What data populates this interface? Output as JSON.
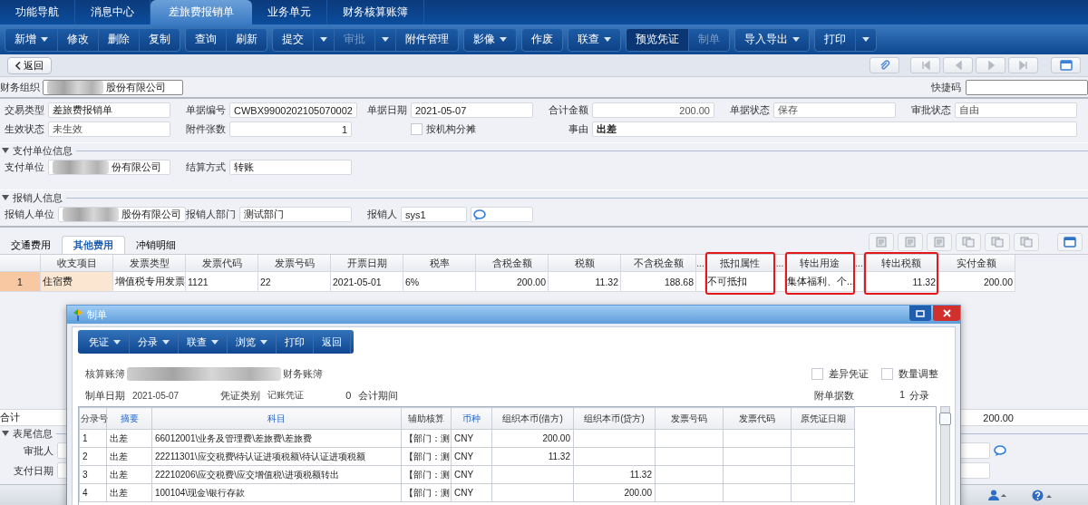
{
  "nav_tabs": [
    {
      "label": "功能导航",
      "selected": false
    },
    {
      "label": "消息中心",
      "selected": false
    },
    {
      "label": "差旅费报销单",
      "selected": true
    },
    {
      "label": "业务单元",
      "selected": false
    },
    {
      "label": "财务核算账簿",
      "selected": false
    }
  ],
  "toolbar": [
    [
      {
        "label": "新增",
        "kind": "menu",
        "disabled": false
      },
      {
        "label": "修改",
        "kind": "plain",
        "disabled": false
      },
      {
        "label": "删除",
        "kind": "plain",
        "disabled": false
      },
      {
        "label": "复制",
        "kind": "plain",
        "disabled": false
      }
    ],
    [
      {
        "label": "查询",
        "kind": "plain",
        "disabled": false
      },
      {
        "label": "刷新",
        "kind": "plain",
        "disabled": false
      }
    ],
    [
      {
        "label": "提交",
        "kind": "split",
        "disabled": false
      },
      {
        "label": "审批",
        "kind": "split",
        "disabled": true
      },
      {
        "label": "附件管理",
        "kind": "plain",
        "disabled": false
      }
    ],
    [
      {
        "label": "影像",
        "kind": "menu",
        "disabled": false
      }
    ],
    [
      {
        "label": "作废",
        "kind": "plain",
        "disabled": false
      }
    ],
    [
      {
        "label": "联查",
        "kind": "menu",
        "disabled": false
      }
    ],
    [
      {
        "label": "预览凭证",
        "kind": "active",
        "disabled": false
      },
      {
        "label": "制单",
        "kind": "plain",
        "disabled": true
      }
    ],
    [
      {
        "label": "导入导出",
        "kind": "menu",
        "disabled": false
      }
    ],
    [
      {
        "label": "打印",
        "kind": "split",
        "disabled": false
      }
    ]
  ],
  "back_button": "返回",
  "org": {
    "label": "财务组织",
    "value": "股份有限公司",
    "redacted": true
  },
  "quick_code": {
    "label": "快捷码"
  },
  "header_fields": [
    {
      "label": "交易类型",
      "value": "差旅费报销单",
      "kind": "text",
      "readonly": false
    },
    {
      "label": "单据编号",
      "value": "CWBX9900202105070002",
      "kind": "text",
      "readonly": false
    },
    {
      "label": "单据日期",
      "value": "2021-05-07",
      "kind": "text",
      "readonly": false
    },
    {
      "label": "合计金额",
      "value": "200.00",
      "kind": "amount",
      "readonly": true
    },
    {
      "label": "单据状态",
      "value": "保存",
      "kind": "text",
      "readonly": true
    },
    {
      "label": "审批状态",
      "value": "自由",
      "kind": "text",
      "readonly": true
    },
    {
      "label": "生效状态",
      "value": "未生效",
      "kind": "text",
      "readonly": true
    },
    {
      "label": "附件张数",
      "value": "1",
      "kind": "amount",
      "readonly": false
    },
    {
      "label": "按机构分摊",
      "kind": "checkbox",
      "checked": false
    },
    {
      "label": "事由",
      "value": "出差",
      "kind": "wide",
      "readonly": false
    }
  ],
  "sections": [
    {
      "title": "支付单位信息",
      "expanded": true,
      "fields": [
        {
          "label": "支付单位",
          "value": "份有限公司",
          "kind": "text",
          "redacted": true
        },
        {
          "label": "结算方式",
          "value": "转账",
          "kind": "text",
          "redacted": false
        }
      ]
    },
    {
      "title": "报销人信息",
      "expanded": true,
      "fields": [
        {
          "label": "报销人单位",
          "value": "股份有限公司",
          "kind": "text",
          "redacted": true
        },
        {
          "label": "报销人部门",
          "value": "测试部门",
          "kind": "text",
          "redacted": false
        },
        {
          "label": "报销人",
          "value": "sys1",
          "kind": "reference",
          "redacted": false
        }
      ]
    }
  ],
  "detail_tabs": [
    {
      "label": "交通费用",
      "selected": false
    },
    {
      "label": "其他费用",
      "selected": true
    },
    {
      "label": "冲销明细",
      "selected": false
    }
  ],
  "detail_table": {
    "columns": [
      {
        "kind": "index",
        "highlighted": false
      },
      {
        "kind": "text",
        "label": "收支项目",
        "highlighted": false
      },
      {
        "kind": "text",
        "label": "发票类型",
        "highlighted": false
      },
      {
        "kind": "text",
        "label": "发票代码",
        "highlighted": false
      },
      {
        "kind": "text",
        "label": "发票号码",
        "highlighted": false
      },
      {
        "kind": "text",
        "label": "开票日期",
        "highlighted": false
      },
      {
        "kind": "text",
        "label": "税率",
        "highlighted": false
      },
      {
        "kind": "amount",
        "label": "含税金额",
        "highlighted": false
      },
      {
        "kind": "amount",
        "label": "税额",
        "highlighted": false
      },
      {
        "kind": "amount",
        "label": "不含税金额",
        "highlighted": false
      },
      {
        "kind": "spacer",
        "label": "...",
        "highlighted": false
      },
      {
        "kind": "text",
        "label": "抵扣属性",
        "highlighted": true
      },
      {
        "kind": "spacer",
        "label": "...",
        "highlighted": false
      },
      {
        "kind": "text",
        "label": "转出用途",
        "highlighted": true
      },
      {
        "kind": "spacer",
        "label": "...",
        "highlighted": false
      },
      {
        "kind": "amount",
        "label": "转出税额",
        "highlighted": true
      },
      {
        "kind": "amount",
        "label": "实付金额",
        "highlighted": false
      }
    ],
    "rows": [
      {
        "selected": true,
        "cells": [
          "1",
          "住宿费",
          "增值税专用发票",
          "1121",
          "22",
          "2021-05-01",
          "6%",
          "200.00",
          "11.32",
          "188.68",
          "",
          "不可抵扣",
          "",
          "集体福利、个...",
          "",
          "11.32",
          "200.00"
        ]
      }
    ]
  },
  "totals": {
    "label": "合计",
    "amount": "200.00"
  },
  "footer_section": {
    "title": "表尾信息",
    "expanded": true,
    "fields": [
      {
        "label": "审批人",
        "kind": "reference"
      },
      {
        "label": "支付日期",
        "kind": "text"
      }
    ]
  },
  "dialog": {
    "title": "制单",
    "toolbar": [
      {
        "label": "凭证",
        "kind": "menu"
      },
      {
        "label": "分录",
        "kind": "menu"
      },
      {
        "label": "联查",
        "kind": "menu"
      },
      {
        "label": "浏览",
        "kind": "menu"
      },
      {
        "label": "打印",
        "kind": "plain"
      },
      {
        "label": "返回",
        "kind": "plain"
      }
    ],
    "book": {
      "label": "核算账簿",
      "value": "财务账簿",
      "redacted": true
    },
    "options": [
      {
        "label": "差异凭证",
        "checked": false
      },
      {
        "label": "数量调整",
        "checked": false
      }
    ],
    "info": [
      {
        "kind": "pair",
        "label": "制单日期",
        "value": "2021-05-07"
      },
      {
        "kind": "pair",
        "label": "凭证类别",
        "value": "记账凭证"
      },
      {
        "kind": "text",
        "text": "0"
      },
      {
        "kind": "text",
        "text": "会计期间"
      }
    ],
    "attachments": {
      "label": "附单据数",
      "value": "1",
      "unit": "分录"
    },
    "columns": [
      {
        "label": "分录号",
        "required": false
      },
      {
        "label": "摘要",
        "required": true
      },
      {
        "label": "科目",
        "required": true
      },
      {
        "label": "辅助核算",
        "required": false
      },
      {
        "label": "币种",
        "required": true
      },
      {
        "label": "组织本币(借方)",
        "required": false
      },
      {
        "label": "组织本币(贷方)",
        "required": false
      },
      {
        "label": "发票号码",
        "required": false
      },
      {
        "label": "发票代码",
        "required": false
      },
      {
        "label": "原凭证日期",
        "required": false
      }
    ],
    "entries": [
      {
        "no": "1",
        "summary": "出差",
        "account": "66012001\\业务及管理费\\差旅费\\差旅费",
        "aux": "【部门：测",
        "currency": "CNY",
        "debit": "200.00"
      },
      {
        "no": "2",
        "summary": "出差",
        "account": "22211301\\应交税费\\待认证进项税额\\待认证进项税额",
        "aux": "【部门：测",
        "currency": "CNY",
        "debit": "11.32"
      },
      {
        "no": "3",
        "summary": "出差",
        "account": "22210206\\应交税费\\应交增值税\\进项税额转出",
        "aux": "【部门：测",
        "currency": "CNY",
        "credit": "11.32"
      },
      {
        "no": "4",
        "summary": "出差",
        "account": "100104\\现金\\银行存款",
        "aux": "【部门：测",
        "currency": "CNY",
        "credit": "200.00"
      }
    ]
  }
}
